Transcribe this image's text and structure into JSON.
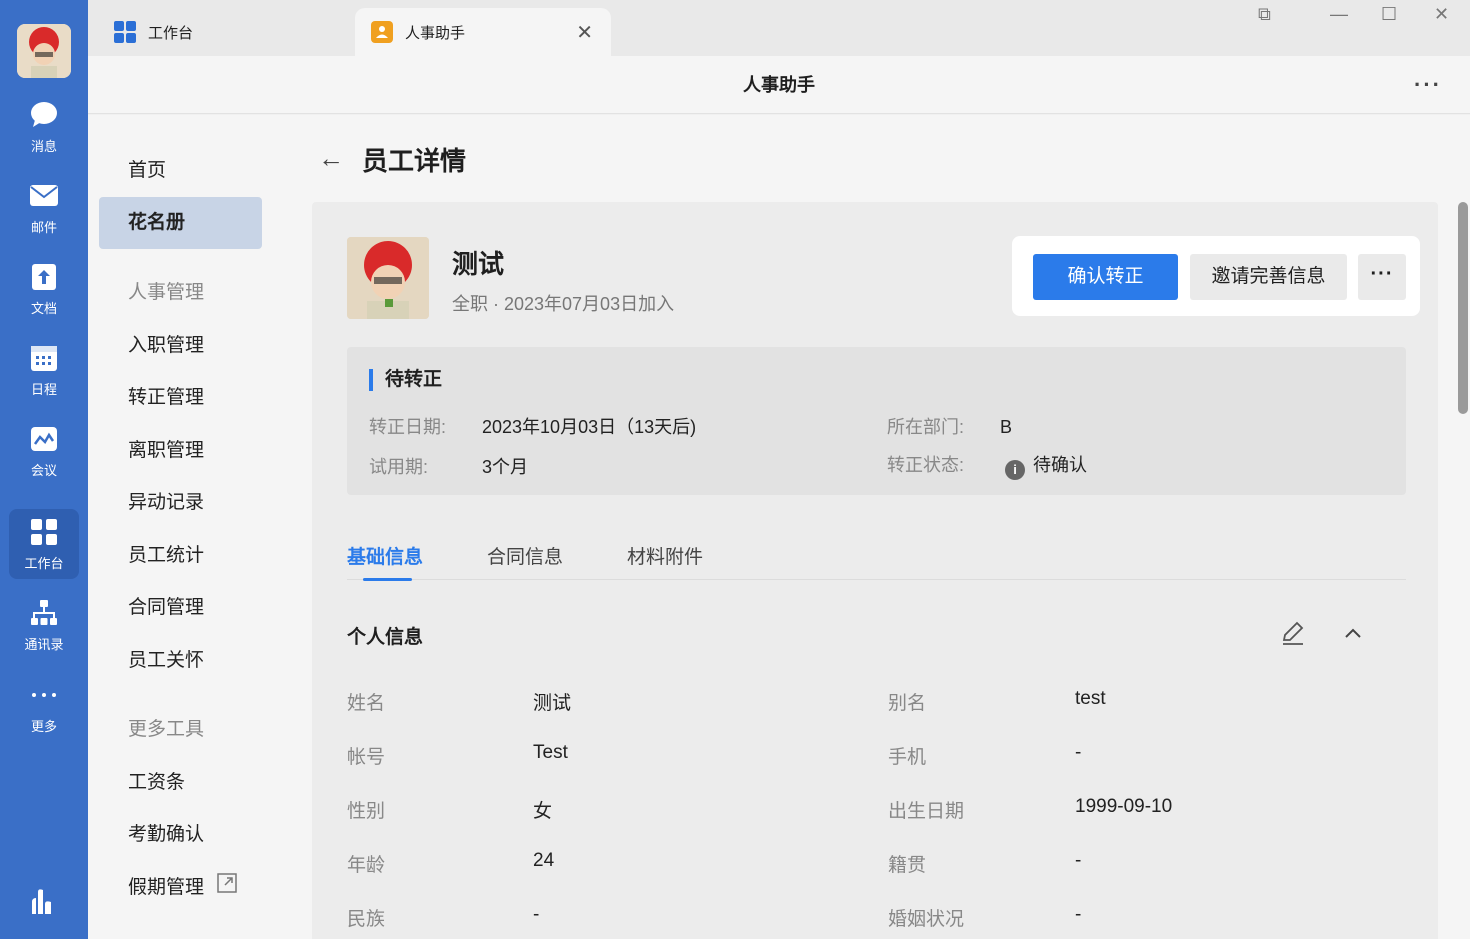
{
  "rail": {
    "items": [
      {
        "label": "消息",
        "icon": "chat-icon"
      },
      {
        "label": "邮件",
        "icon": "mail-icon"
      },
      {
        "label": "文档",
        "icon": "doc-icon"
      },
      {
        "label": "日程",
        "icon": "calendar-icon"
      },
      {
        "label": "会议",
        "icon": "meeting-icon"
      },
      {
        "label": "工作台",
        "icon": "workbench-icon"
      },
      {
        "label": "通讯录",
        "icon": "contacts-icon"
      },
      {
        "label": "更多",
        "icon": "more-icon"
      }
    ]
  },
  "tabs": {
    "tab1": "工作台",
    "tab2": "人事助手"
  },
  "titlebar": {
    "title": "人事助手",
    "more": "···"
  },
  "side": {
    "home": "首页",
    "roster": "花名册",
    "group1": "人事管理",
    "onboard": "入职管理",
    "regular": "转正管理",
    "leave": "离职管理",
    "change": "异动记录",
    "stats": "员工统计",
    "contract": "合同管理",
    "care": "员工关怀",
    "group2": "更多工具",
    "salary": "工资条",
    "attendance": "考勤确认",
    "holiday": "假期管理"
  },
  "page": {
    "title": "员工详情",
    "name": "测试",
    "sub": "全职 · 2023年07月03日加入",
    "btn_confirm": "确认转正",
    "btn_invite": "邀请完善信息",
    "btn_more": "···"
  },
  "status": {
    "title": "待转正",
    "date_label": "转正日期:",
    "date_value": "2023年10月03日（13天后)",
    "probation_label": "试用期:",
    "probation_value": "3个月",
    "dept_label": "所在部门:",
    "dept_value": "B",
    "state_label": "转正状态:",
    "state_value": "待确认"
  },
  "detail_tabs": [
    "基础信息",
    "合同信息",
    "材料附件"
  ],
  "section": {
    "title": "个人信息"
  },
  "fields": {
    "name_label": "姓名",
    "name_value": "测试",
    "alias_label": "别名",
    "alias_value": "test",
    "account_label": "帐号",
    "account_value": "Test",
    "phone_label": "手机",
    "phone_value": "-",
    "gender_label": "性别",
    "gender_value": "女",
    "birth_label": "出生日期",
    "birth_value": "1999-09-10",
    "age_label": "年龄",
    "age_value": "24",
    "native_label": "籍贯",
    "native_value": "-",
    "ethnic_label": "民族",
    "ethnic_value": "-",
    "marital_label": "婚姻状况",
    "marital_value": "-"
  },
  "colors": {
    "rail": "#3a6fc7",
    "accent": "#2b7bea"
  }
}
